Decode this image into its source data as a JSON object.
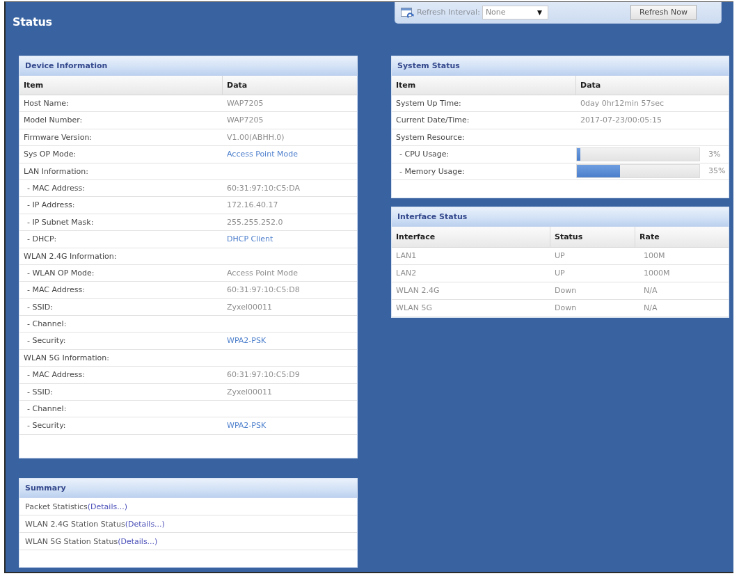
{
  "page": {
    "title": "Status"
  },
  "toolbar": {
    "label": "Refresh Interval:",
    "interval": {
      "value": "None"
    },
    "button": "Refresh Now"
  },
  "device_information": {
    "title": "Device Information",
    "columns": [
      "Item",
      "Data"
    ],
    "rows": [
      {
        "item": "Host Name:",
        "data": "WAP7205",
        "link": false
      },
      {
        "item": "Model Number:",
        "data": "WAP7205",
        "link": false
      },
      {
        "item": "Firmware Version:",
        "data": "V1.00(ABHH.0)",
        "link": false
      },
      {
        "item": "Sys OP Mode:",
        "data": "Access Point Mode",
        "link": true
      },
      {
        "item": "LAN Information:",
        "children": [
          {
            "item": "- MAC Address:",
            "data": "60:31:97:10:C5:DA",
            "link": false
          },
          {
            "item": "- IP Address:",
            "data": "172.16.40.17",
            "link": false
          },
          {
            "item": "- IP Subnet Mask:",
            "data": "255.255.252.0",
            "link": false
          },
          {
            "item": "- DHCP:",
            "data": "DHCP Client",
            "link": true
          }
        ]
      },
      {
        "item": "WLAN 2.4G Information:",
        "children": [
          {
            "item": "- WLAN OP Mode:",
            "data": "Access Point Mode",
            "link": false
          },
          {
            "item": "- MAC Address:",
            "data": "60:31:97:10:C5:D8",
            "link": false
          },
          {
            "item": "- SSID:",
            "data": "Zyxel00011",
            "link": false
          },
          {
            "item": "- Channel:"
          },
          {
            "item": "- Security:",
            "data": "WPA2-PSK",
            "link": true
          }
        ]
      },
      {
        "item": "WLAN 5G Information:",
        "children": [
          {
            "item": "- MAC Address:",
            "data": "60:31:97:10:C5:D9",
            "link": false
          },
          {
            "item": "- SSID:",
            "data": "Zyxel00011",
            "link": false
          },
          {
            "item": "- Channel:"
          },
          {
            "item": "- Security:",
            "data": "WPA2-PSK",
            "link": true
          }
        ]
      }
    ]
  },
  "summary": {
    "title": "Summary",
    "items": [
      {
        "label": "Packet Statistics",
        "link": "(Details...)"
      },
      {
        "label": "WLAN 2.4G Station Status",
        "link": "(Details...)"
      },
      {
        "label": "WLAN 5G Station Status",
        "link": "(Details...)"
      }
    ]
  },
  "system_status": {
    "title": "System Status",
    "columns": [
      "Item",
      "Data"
    ],
    "rows": [
      {
        "kind": "text",
        "item": "System Up Time:",
        "data": "0day 0hr12min 57sec"
      },
      {
        "kind": "text",
        "item": "Current Date/Time:",
        "data": "2017-07-23/00:05:15"
      },
      {
        "kind": "text",
        "item": "System Resource:",
        "children": [
          {
            "kind": "meter",
            "item": "- CPU Usage:",
            "level": 0.03,
            "reading": "3%"
          },
          {
            "kind": "meter",
            "item": "- Memory Usage:",
            "level": 0.35,
            "reading": "35%"
          }
        ]
      }
    ]
  },
  "interface_status": {
    "title": "Interface Status",
    "columns": [
      "Interface",
      "Status",
      "Rate"
    ],
    "rows": [
      [
        "LAN1",
        "UP",
        "100M"
      ],
      [
        "LAN2",
        "UP",
        "1000M"
      ],
      [
        "WLAN 2.4G",
        "Down",
        "N/A"
      ],
      [
        "WLAN 5G",
        "Down",
        "N/A"
      ]
    ]
  }
}
